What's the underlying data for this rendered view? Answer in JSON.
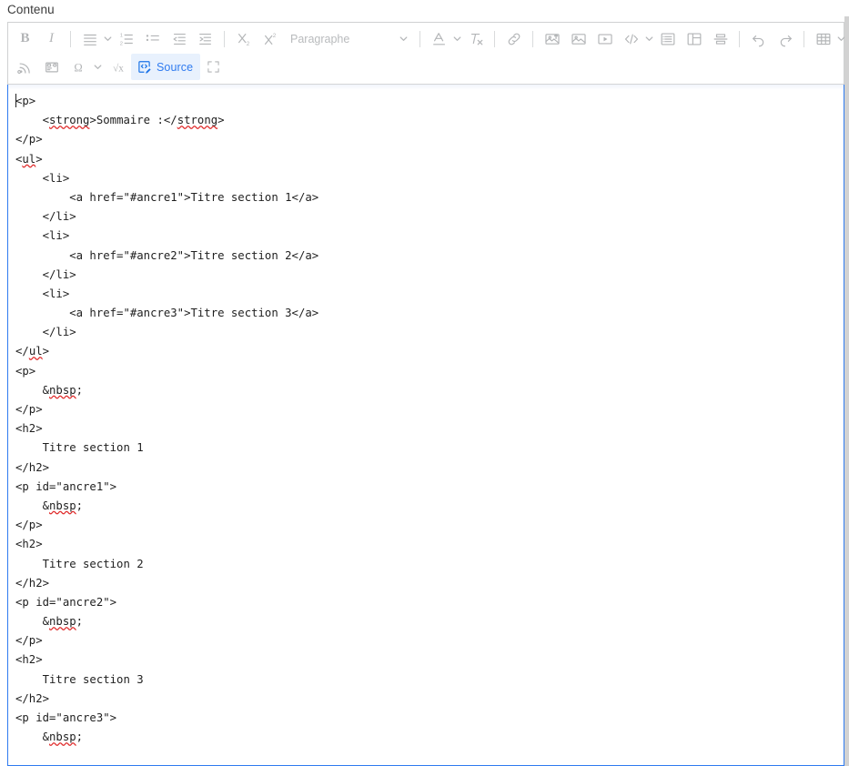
{
  "field": {
    "label": "Contenu"
  },
  "toolbar": {
    "rows": [
      [
        {
          "name": "bold-button",
          "icon": "bold",
          "label": "B",
          "type": "glyph-bold"
        },
        {
          "name": "italic-button",
          "icon": "italic",
          "label": "I",
          "type": "glyph-italic"
        },
        {
          "name": "separator",
          "type": "sep"
        },
        {
          "name": "text-alignment-button",
          "icon": "align-left-icon",
          "type": "svg"
        },
        {
          "name": "text-alignment-dropdown-arrow",
          "icon": "chevron-down-icon",
          "type": "caret"
        },
        {
          "name": "numbered-list-button",
          "icon": "numbered-list-icon",
          "type": "svg"
        },
        {
          "name": "bulleted-list-button",
          "icon": "bulleted-list-icon",
          "type": "svg"
        },
        {
          "name": "decrease-indent-button",
          "icon": "outdent-icon",
          "type": "svg"
        },
        {
          "name": "increase-indent-button",
          "icon": "indent-icon",
          "type": "svg"
        },
        {
          "name": "separator",
          "type": "sep"
        },
        {
          "name": "subscript-button",
          "icon": "subscript-icon",
          "type": "svg"
        },
        {
          "name": "superscript-button",
          "icon": "superscript-icon",
          "type": "svg"
        },
        {
          "name": "paragraph-format-dropdown",
          "icon": "chevron-down-icon",
          "type": "combo",
          "label": "Paragraphe"
        },
        {
          "name": "separator",
          "type": "sep"
        },
        {
          "name": "font-color-button",
          "icon": "font-color-icon",
          "type": "svg"
        },
        {
          "name": "font-color-dropdown-arrow",
          "icon": "chevron-down-icon",
          "type": "caret"
        },
        {
          "name": "remove-format-button",
          "icon": "remove-format-icon",
          "type": "svg"
        },
        {
          "name": "separator",
          "type": "sep"
        },
        {
          "name": "link-button",
          "icon": "link-icon",
          "type": "svg"
        },
        {
          "name": "separator",
          "type": "sep"
        },
        {
          "name": "upload-image-button",
          "icon": "image-upload-icon",
          "type": "svg"
        },
        {
          "name": "insert-image-button",
          "icon": "image-icon",
          "type": "svg"
        },
        {
          "name": "insert-video-button",
          "icon": "video-icon",
          "type": "svg"
        },
        {
          "name": "insert-code-button",
          "icon": "code-icon",
          "type": "svg"
        },
        {
          "name": "insert-code-dropdown-arrow",
          "icon": "chevron-down-icon",
          "type": "caret"
        },
        {
          "name": "insert-block-button",
          "icon": "block-list-icon",
          "type": "svg"
        },
        {
          "name": "insert-layout-button",
          "icon": "layout-icon",
          "type": "svg"
        },
        {
          "name": "page-break-button",
          "icon": "page-break-icon",
          "type": "svg"
        },
        {
          "name": "separator",
          "type": "sep"
        },
        {
          "name": "undo-button",
          "icon": "undo-icon",
          "type": "svg"
        },
        {
          "name": "redo-button",
          "icon": "redo-icon",
          "type": "svg"
        },
        {
          "name": "separator",
          "type": "sep"
        },
        {
          "name": "insert-table-button",
          "icon": "table-icon",
          "type": "svg"
        },
        {
          "name": "insert-table-dropdown-arrow",
          "icon": "chevron-down-icon",
          "type": "caret"
        }
      ],
      [
        {
          "name": "rss-feed-button",
          "icon": "rss-icon",
          "type": "svg"
        },
        {
          "name": "insert-template-button",
          "icon": "template-icon",
          "type": "svg"
        },
        {
          "name": "special-character-button",
          "icon": "omega-icon",
          "type": "svg"
        },
        {
          "name": "special-character-dropdown-arrow",
          "icon": "chevron-down-icon",
          "type": "caret"
        },
        {
          "name": "math-formula-button",
          "icon": "math-icon",
          "type": "svg"
        },
        {
          "name": "source-button",
          "icon": "source-icon",
          "type": "source",
          "label": "Source"
        },
        {
          "name": "fullscreen-button",
          "icon": "fullscreen-icon",
          "type": "svg"
        }
      ]
    ]
  },
  "source": {
    "lines": [
      {
        "text": "<p>",
        "caret": true
      },
      {
        "text": "    <strong>Sommaire :</strong>",
        "spell": [
          "strong",
          "strong"
        ]
      },
      {
        "text": "</p>"
      },
      {
        "text": "<ul>",
        "spell": [
          "ul"
        ]
      },
      {
        "text": "    <li>"
      },
      {
        "text": "        <a href=\"#ancre1\">Titre section 1</a>"
      },
      {
        "text": "    </li>"
      },
      {
        "text": "    <li>"
      },
      {
        "text": "        <a href=\"#ancre2\">Titre section 2</a>"
      },
      {
        "text": "    </li>"
      },
      {
        "text": "    <li>"
      },
      {
        "text": "        <a href=\"#ancre3\">Titre section 3</a>"
      },
      {
        "text": "    </li>"
      },
      {
        "text": "</ul>",
        "spell": [
          "ul"
        ]
      },
      {
        "text": "<p>"
      },
      {
        "text": "    &nbsp;",
        "spell": [
          "nbsp"
        ]
      },
      {
        "text": "</p>"
      },
      {
        "text": "<h2>"
      },
      {
        "text": "    Titre section 1"
      },
      {
        "text": "</h2>"
      },
      {
        "text": "<p id=\"ancre1\">"
      },
      {
        "text": "    &nbsp;",
        "spell": [
          "nbsp"
        ]
      },
      {
        "text": "</p>"
      },
      {
        "text": "<h2>"
      },
      {
        "text": "    Titre section 2"
      },
      {
        "text": "</h2>"
      },
      {
        "text": "<p id=\"ancre2\">"
      },
      {
        "text": "    &nbsp;",
        "spell": [
          "nbsp"
        ]
      },
      {
        "text": "</p>"
      },
      {
        "text": "<h2>"
      },
      {
        "text": "    Titre section 3"
      },
      {
        "text": "</h2>"
      },
      {
        "text": "<p id=\"ancre3\">"
      },
      {
        "text": "    &nbsp;",
        "spell": [
          "nbsp"
        ]
      }
    ]
  },
  "colors": {
    "accent": "#2f7bf0",
    "source_active_bg": "#e8f1fd",
    "source_active_fg": "#2f7bf0",
    "toolbar_icon": "#b3b5b7",
    "spellcheck_underline": "#e02c2c",
    "code_text": "#1f1f1f"
  }
}
